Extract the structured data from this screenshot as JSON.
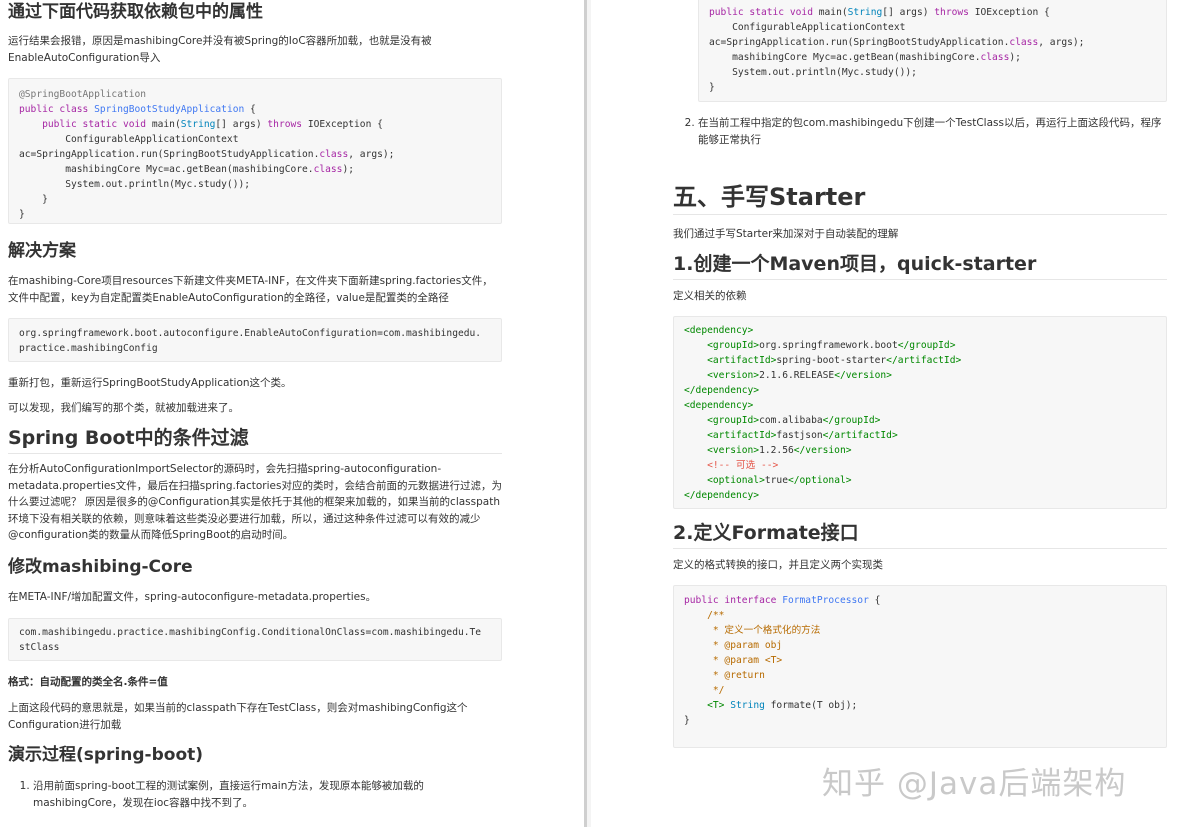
{
  "left": {
    "heading1": "通过下面代码获取依赖包中的属性",
    "para1": "运行结果会报错，原因是mashibingCore并没有被Spring的IoC容器所加载，也就是没有被EnableAutoConfiguration导入",
    "code1": [
      "@SpringBootApplication",
      "public class SpringBootStudyApplication {",
      "    public static void main(String[] args) throws IOException {",
      "        ConfigurableApplicationContext",
      "ac=SpringApplication.run(SpringBootStudyApplication.class, args);",
      "        mashibingCore Myc=ac.getBean(mashibingCore.class);",
      "        System.out.println(Myc.study());",
      "    }",
      "}"
    ],
    "heading2": "解决方案",
    "para2": "在mashibing-Core项目resources下新建文件夹META-INF，在文件夹下面新建spring.factories文件，文件中配置，key为自定配置类EnableAutoConfiguration的全路径，value是配置类的全路径",
    "code2": [
      "org.springframework.boot.autoconfigure.EnableAutoConfiguration=com.mashibingedu.",
      "practice.mashibingConfig"
    ],
    "para3": "重新打包，重新运行SpringBootStudyApplication这个类。",
    "para4": "可以发现，我们编写的那个类，就被加载进来了。",
    "heading3": "Spring Boot中的条件过滤",
    "para5": "在分析AutoConfigurationImportSelector的源码时，会先扫描spring-autoconfiguration-metadata.properties文件，最后在扫描spring.factories对应的类时，会结合前面的元数据进行过滤，为什么要过滤呢？ 原因是很多的@Configuration其实是依托于其他的框架来加载的，如果当前的classpath环境下没有相关联的依赖，则意味着这些类没必要进行加载，所以，通过这种条件过滤可以有效的减少@configuration类的数量从而降低SpringBoot的启动时间。",
    "heading4": "修改mashibing-Core",
    "para6": "在META-INF/增加配置文件，spring-autoconfigure-metadata.properties。",
    "code3": [
      "com.mashibingedu.practice.mashibingConfig.ConditionalOnClass=com.mashibingedu.Te",
      "stClass"
    ],
    "format_label": "格式：自动配置的类全名.条件=值",
    "para7": "上面这段代码的意思就是，如果当前的classpath下存在TestClass，则会对mashibingConfig这个Configuration进行加载",
    "heading5": "演示过程(spring-boot)",
    "step1": "沿用前面spring-boot工程的测试案例，直接运行main方法，发现原本能够被加载的mashibingCore，发现在ioc容器中找不到了。"
  },
  "right": {
    "code_top": [
      "public static void main(String[] args) throws IOException {",
      "    ConfigurableApplicationContext",
      "ac=SpringApplication.run(SpringBootStudyApplication.class, args);",
      "    mashibingCore Myc=ac.getBean(mashibingCore.class);",
      "    System.out.println(Myc.study());",
      "}"
    ],
    "step2": "在当前工程中指定的包com.mashibingedu下创建一个TestClass以后，再运行上面这段代码，程序能够正常执行",
    "heading_big": "五、手写Starter",
    "para1": "我们通过手写Starter来加深对于自动装配的理解",
    "heading_m1": "1.创建一个Maven项目，quick-starter",
    "para2": "定义相关的依赖",
    "code_xml": [
      "<dependency>",
      "    <groupId>org.springframework.boot</groupId>",
      "    <artifactId>spring-boot-starter</artifactId>",
      "    <version>2.1.6.RELEASE</version>",
      "</dependency>",
      "<dependency>",
      "    <groupId>com.alibaba</groupId>",
      "    <artifactId>fastjson</artifactId>",
      "    <version>1.2.56</version>",
      "    <!-- 可选 -->",
      "    <optional>true</optional>",
      "</dependency>"
    ],
    "heading_m2": "2.定义Formate接口",
    "para3": "定义的格式转换的接口，并且定义两个实现类",
    "code_iface": [
      "public interface FormatProcessor {",
      "    /**",
      "     * 定义一个格式化的方法",
      "     * @param obj",
      "     * @param <T>",
      "     * @return",
      "     */",
      "    <T> String formate(T obj);",
      "}"
    ]
  },
  "watermark": "知乎 @Java后端架构"
}
